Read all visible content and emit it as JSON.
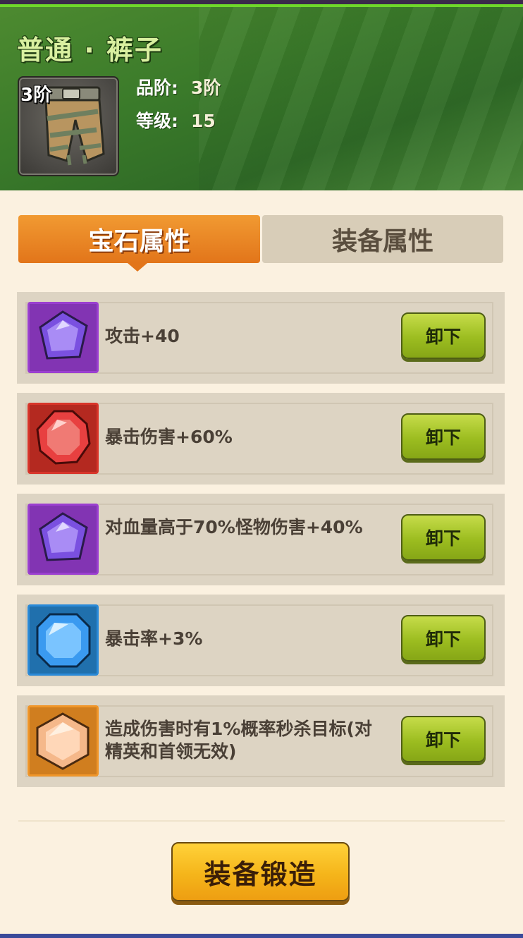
{
  "header": {
    "title": "普通 · 裤子",
    "item_icon_name": "pants-icon",
    "tier_tag": "3阶",
    "grade_label": "品阶:",
    "grade_value": "3阶",
    "level_label": "等级:",
    "level_value": "15"
  },
  "tabs": [
    {
      "label": "宝石属性",
      "active": true
    },
    {
      "label": "装备属性",
      "active": false
    }
  ],
  "gems": [
    {
      "icon": "purple-gem-icon",
      "color": "#9b3fd0",
      "text": "攻击+40",
      "button": "卸下"
    },
    {
      "icon": "red-gem-icon",
      "color": "#d8352a",
      "text": "暴击伤害+60%",
      "button": "卸下"
    },
    {
      "icon": "purple-gem-icon",
      "color": "#9b3fd0",
      "text": "对血量高于70%怪物伤害+40%",
      "button": "卸下"
    },
    {
      "icon": "blue-gem-icon",
      "color": "#2a8ad8",
      "text": "暴击率+3%",
      "button": "卸下"
    },
    {
      "icon": "orange-gem-icon",
      "color": "#f0962a",
      "text": "造成伤害时有1%概率秒杀目标(对精英和首领无效)",
      "button": "卸下"
    }
  ],
  "footer": {
    "forge_label": "装备锻造"
  }
}
